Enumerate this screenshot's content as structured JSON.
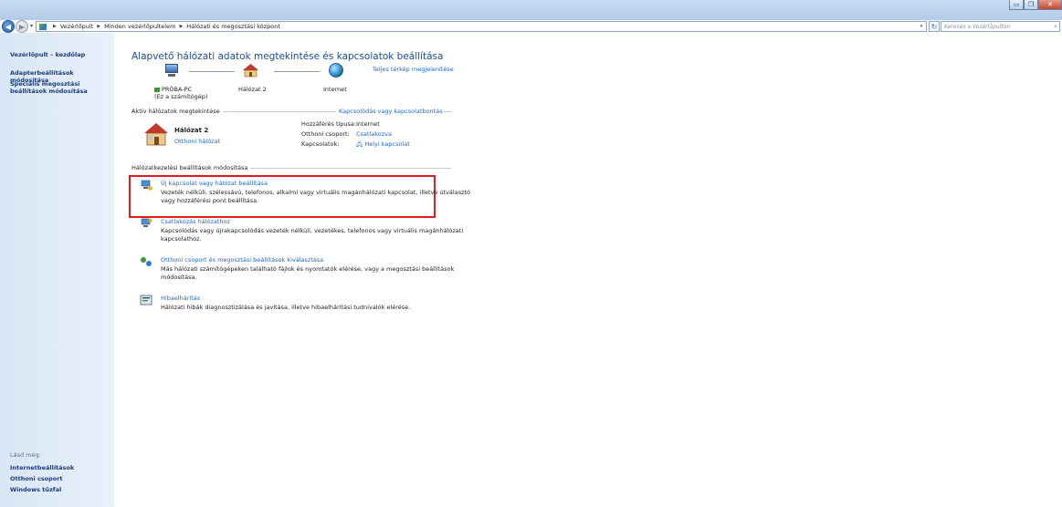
{
  "window": {
    "buttons": {
      "minimize": "▭",
      "maximize": "❐",
      "close": "✕"
    }
  },
  "address": {
    "crumbs": [
      "Vezérlőpult",
      "Minden vezérlőpultelem",
      "Hálózati és megosztási központ"
    ],
    "search_placeholder": "Keresés a Vezérlőpulton"
  },
  "sidebar": {
    "home": "Vezérlőpult – kezdőlap",
    "adapter": "Adapterbeállítások módosítása",
    "advanced_line1": "Speciális megosztási",
    "advanced_line2": "beállítások módosítása",
    "see_also": "Lásd még:",
    "internet_options": "Internetbeállítások",
    "homegroup": "Otthoni csoport",
    "firewall": "Windows tűzfal"
  },
  "main": {
    "title": "Alapvető hálózati adatok megtekintése és kapcsolatok beállítása",
    "full_map": "Teljes térkép megjelenítése",
    "map": {
      "pc_name": "PRÓBA-PC",
      "pc_sub": "(Ez a számítógép)",
      "network": "Hálózat 2",
      "internet": "Internet"
    },
    "active_header": "Aktív hálózatok megtekintése",
    "connect_disconnect": "Kapcsolódás vagy kapcsolatbontás",
    "active": {
      "name": "Hálózat 2",
      "type": "Otthoni hálózat",
      "access_label": "Hozzáférés típusa:",
      "access_value": "Internet",
      "homegroup_label": "Otthoni csoport:",
      "homegroup_value": "Csatlakozva",
      "connections_label": "Kapcsolatok:",
      "connections_value": "Helyi kapcsolat"
    },
    "settings_header": "Hálózatkezelési beállítások módosítása",
    "tasks": [
      {
        "title": "Új kapcsolat vagy hálózat beállítása",
        "desc": "Vezeték nélküli, szélessávú, telefonos, alkalmi vagy virtuális magánhálózati kapcsolat, illetve útválasztó vagy hozzáférési pont beállítása."
      },
      {
        "title": "Csatlakozás hálózathoz",
        "desc": "Kapcsolódás vagy újrakapcsolódás vezeték nélküli, vezetékes, telefonos vagy virtuális magánhálózati kapcsolathoz."
      },
      {
        "title": "Otthoni csoport és megosztási beállítások kiválasztása",
        "desc": "Más hálózati számítógépeken található fájlok és nyomtatók elérése, vagy a megosztási beállítások módosítása."
      },
      {
        "title": "Hibaelhárítás",
        "desc": "Hálózati hibák diagnosztizálása és javítása, illetve hibaelhárítási tudnivalók elérése."
      }
    ]
  },
  "colors": {
    "link": "#1f66c7",
    "title": "#1a4c90",
    "highlight": "#e01b1b",
    "sidebar": "#d8e6f5"
  }
}
